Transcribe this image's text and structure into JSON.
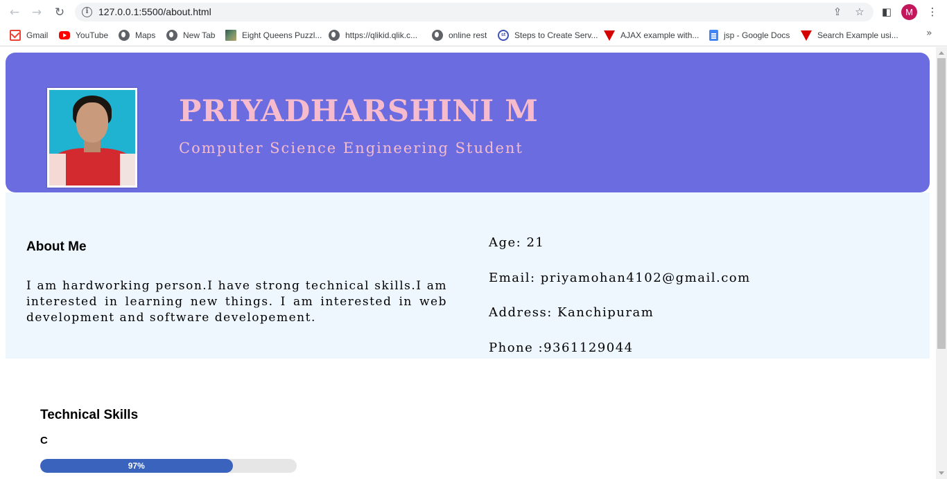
{
  "browser": {
    "url": "127.0.0.1:5500/about.html",
    "avatar_initial": "M",
    "bookmarks": [
      {
        "label": "Gmail",
        "icon": "gmail-icon"
      },
      {
        "label": "YouTube",
        "icon": "youtube-icon"
      },
      {
        "label": "Maps",
        "icon": "globe-icon"
      },
      {
        "label": "New Tab",
        "icon": "globe-icon"
      },
      {
        "label": "Eight Queens Puzzl...",
        "icon": "image-icon"
      },
      {
        "label": "https://qlikid.qlik.c...",
        "icon": "globe-icon"
      },
      {
        "label": "online rest",
        "icon": "globe-icon"
      },
      {
        "label": "Steps to Create Serv...",
        "icon": "st-icon"
      },
      {
        "label": "AJAX example with...",
        "icon": "v-icon"
      },
      {
        "label": "jsp - Google Docs",
        "icon": "docs-icon"
      },
      {
        "label": "Search Example usi...",
        "icon": "v-icon"
      }
    ]
  },
  "header": {
    "name": "PRIYADHARSHINI M",
    "tagline": "Computer Science Engineering Student",
    "colors": {
      "background": "#6b6ce0",
      "text": "#f6bccd"
    }
  },
  "about": {
    "title": "About Me",
    "text": "I am hardworking person.I have strong technical skills.I am interested in learning new things. I am interested in web development and software developement.",
    "age": "Age: 21",
    "email": "Email: priyamohan4102@gmail.com",
    "address": "Address: Kanchipuram",
    "phone": "Phone :9361129044"
  },
  "skills": {
    "title": "Technical Skills",
    "items": [
      {
        "name": "C",
        "label": "97%",
        "level": 0.75
      }
    ],
    "bar_color": "#3a63bd"
  }
}
